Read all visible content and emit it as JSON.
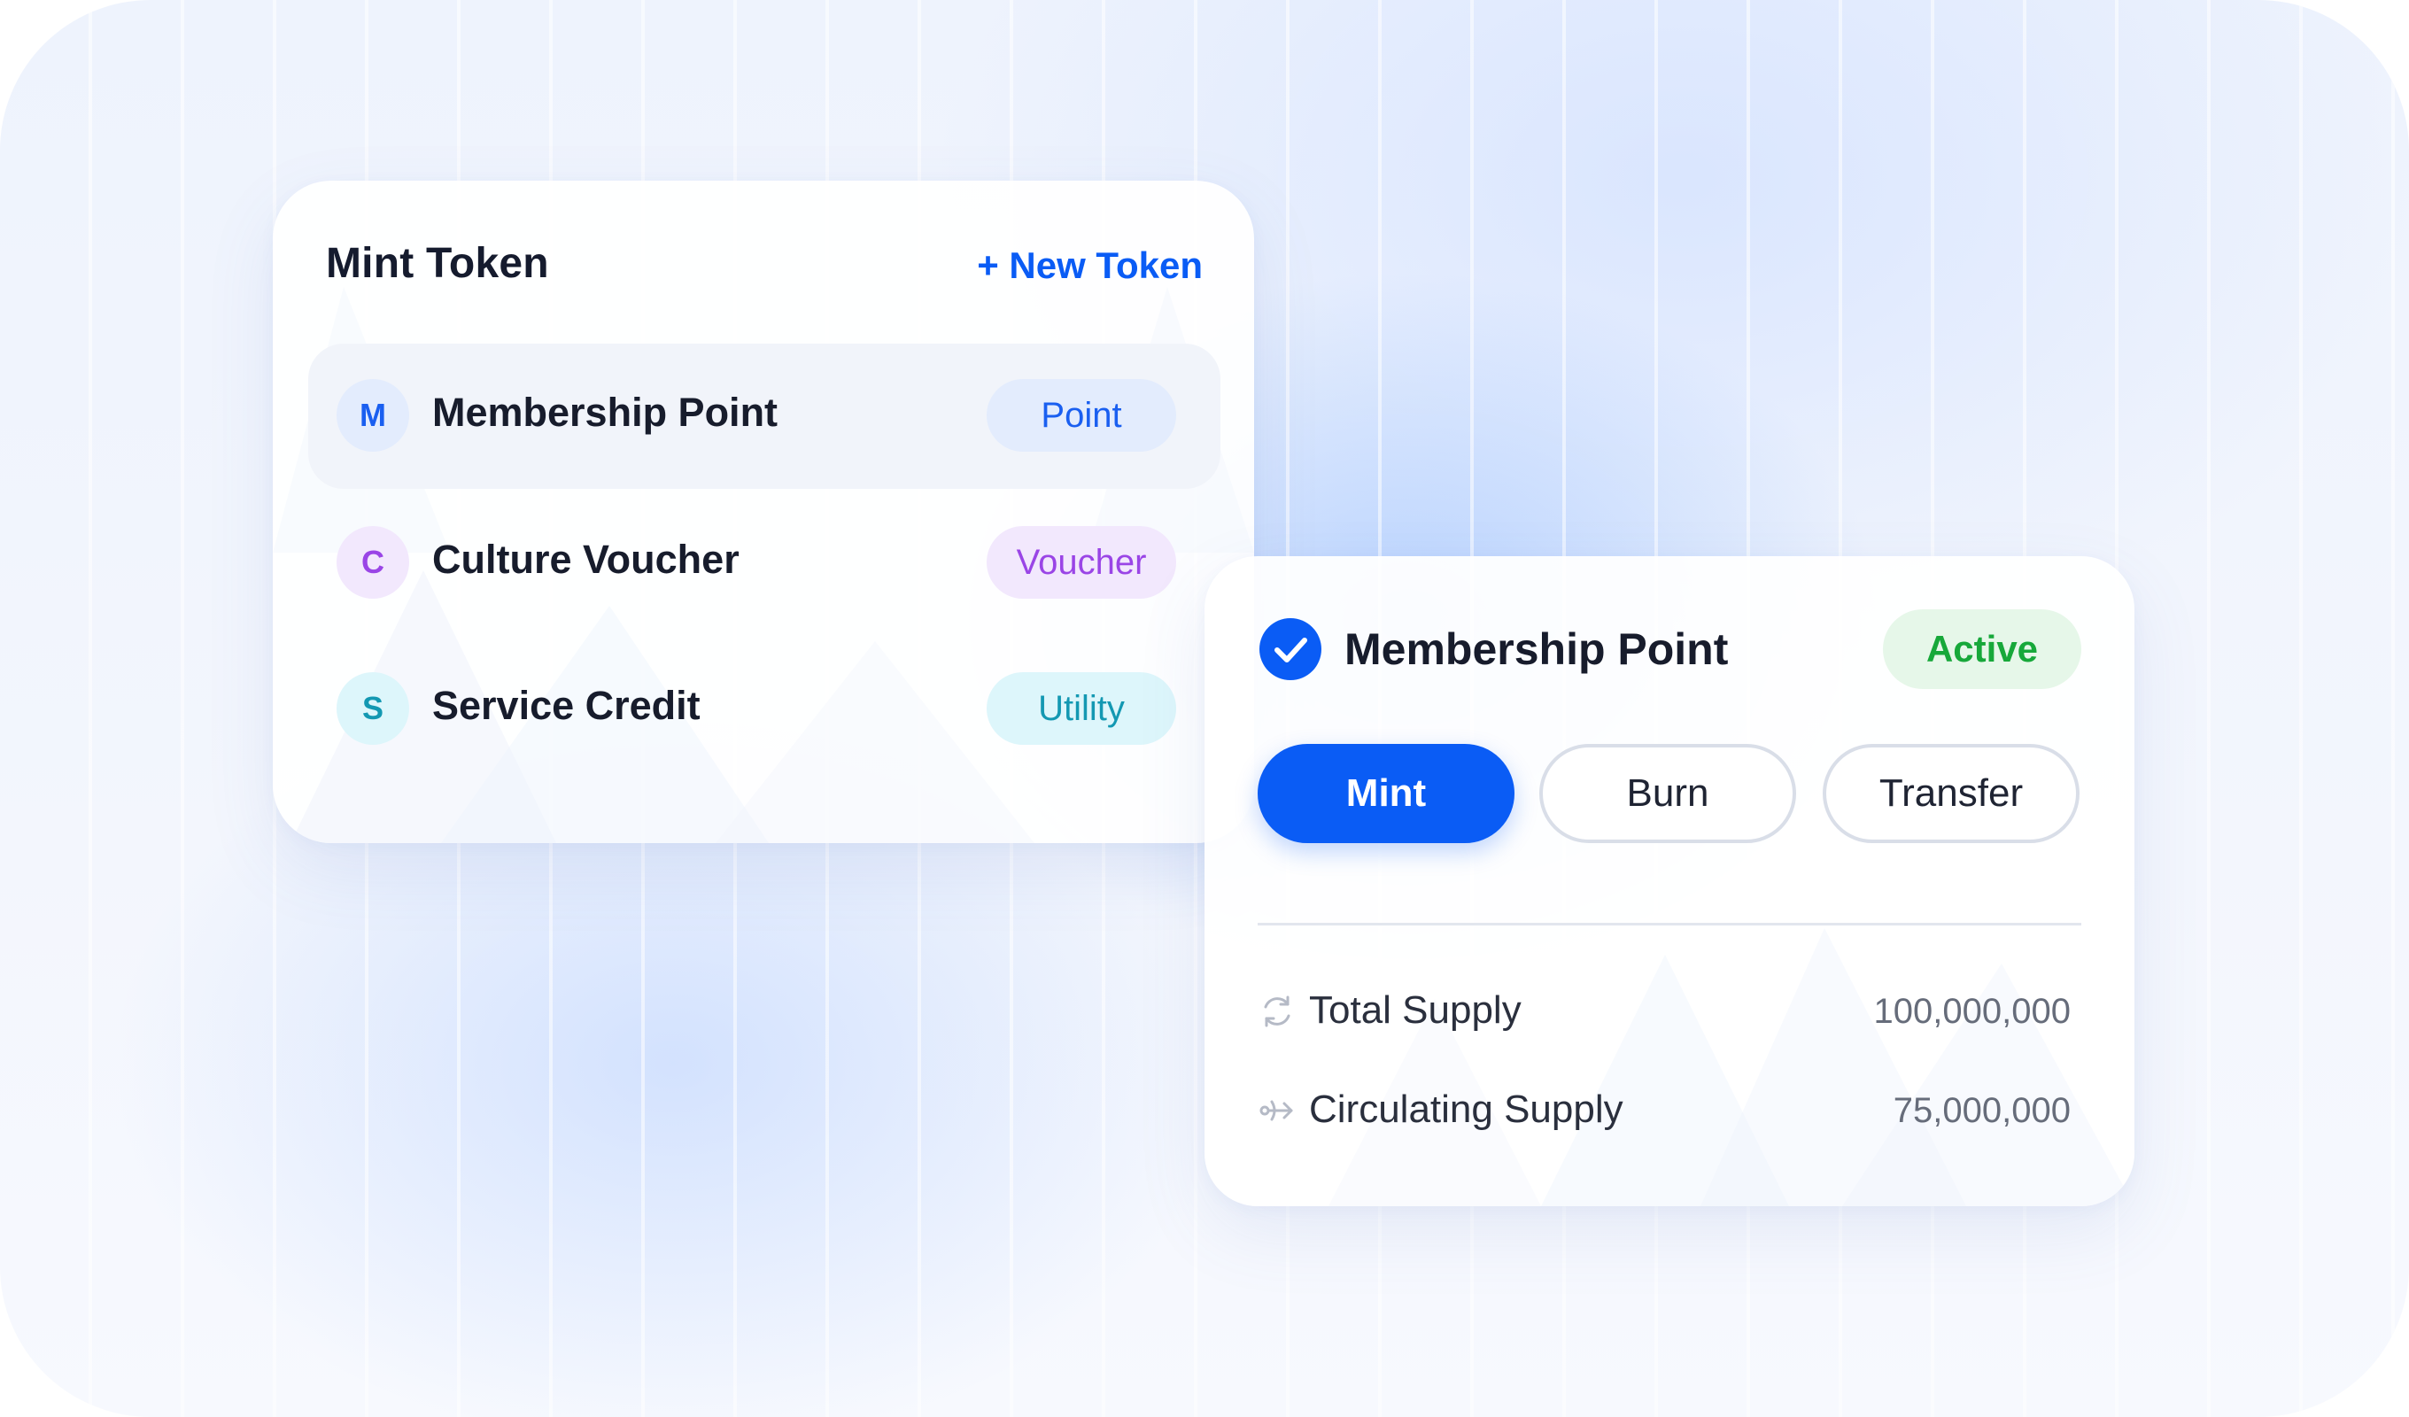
{
  "mint_panel": {
    "title": "Mint Token",
    "new_token_label": "+ New Token",
    "tokens": [
      {
        "initial": "M",
        "name": "Membership Point",
        "tag": "Point",
        "tag_bg": "#e3ecfd",
        "tag_color": "#1a5ff0",
        "avatar_bg": "#e3ecfd",
        "avatar_color": "#1a5ff0"
      },
      {
        "initial": "C",
        "name": "Culture Voucher",
        "tag": "Voucher",
        "tag_bg": "#f2e8fd",
        "tag_color": "#9a45e6",
        "avatar_bg": "#f2e8fd",
        "avatar_color": "#9a45e6"
      },
      {
        "initial": "S",
        "name": "Service Credit",
        "tag": "Utility",
        "tag_bg": "#ddf6fb",
        "tag_color": "#1398b2",
        "avatar_bg": "#ddf6fb",
        "avatar_color": "#1398b2"
      }
    ]
  },
  "detail_panel": {
    "title": "Membership Point",
    "status": "Active",
    "actions": {
      "mint": "Mint",
      "burn": "Burn",
      "transfer": "Transfer"
    },
    "stats": [
      {
        "icon": "refresh-icon",
        "label": "Total Supply",
        "value": "100,000,000"
      },
      {
        "icon": "flow-arrow-icon",
        "label": "Circulating Supply",
        "value": "75,000,000"
      }
    ]
  },
  "colors": {
    "accent": "#0a5cf5",
    "status_green": "#17a83a",
    "status_green_bg": "#e6f7e9"
  }
}
